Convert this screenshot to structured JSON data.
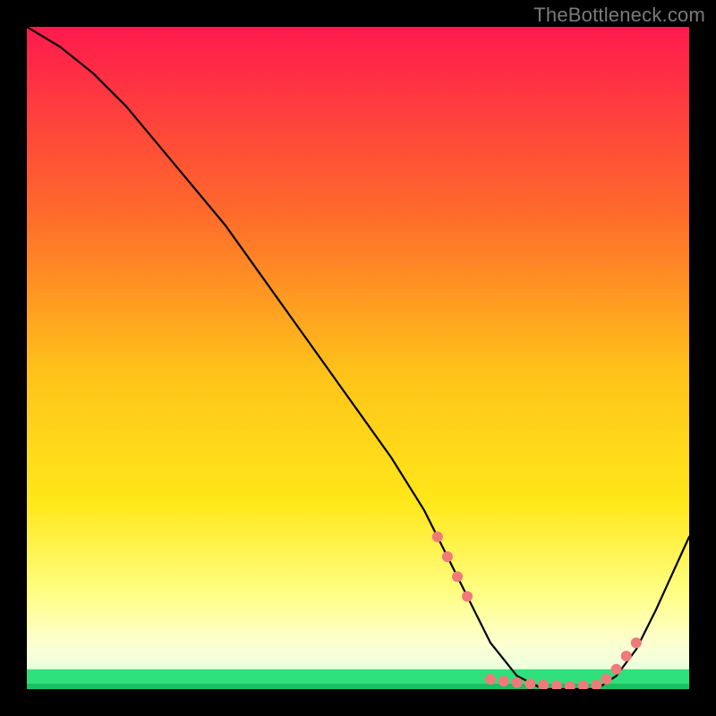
{
  "watermark": "TheBottleneck.com",
  "chart_data": {
    "type": "line",
    "title": "",
    "xlabel": "",
    "ylabel": "",
    "xlim": [
      0,
      100
    ],
    "ylim": [
      0,
      100
    ],
    "grid": false,
    "background_gradient_colors": [
      "#ff1a4d",
      "#ff8a2b",
      "#ffe21a",
      "#ffff66",
      "#ffffcc",
      "#2fe07a"
    ],
    "series": [
      {
        "name": "bottleneck-curve",
        "x": [
          0,
          5,
          10,
          15,
          20,
          25,
          30,
          35,
          40,
          45,
          50,
          55,
          60,
          62,
          65,
          68,
          70,
          74,
          78,
          83,
          86,
          89,
          92,
          95,
          100
        ],
        "y": [
          100,
          97,
          93,
          88,
          82,
          76,
          70,
          63,
          56,
          49,
          42,
          35,
          27,
          23,
          17,
          11,
          7,
          2,
          0,
          0,
          0,
          2,
          6,
          12,
          23
        ]
      }
    ],
    "markers": {
      "name": "highlight-dots",
      "x": [
        62,
        63.5,
        65,
        66.5,
        70,
        72,
        74,
        76,
        78,
        80,
        82,
        84,
        86,
        87.5,
        89,
        90.5,
        92
      ],
      "y": [
        23,
        20,
        17,
        14,
        1.5,
        1.2,
        1.0,
        0.8,
        0.6,
        0.5,
        0.4,
        0.5,
        0.6,
        1.5,
        3,
        5,
        7
      ],
      "color": "#f07a7a",
      "radius": 6
    },
    "floor_band": {
      "y_from": 0,
      "y_to": 3,
      "color": "#2fe07a"
    }
  }
}
